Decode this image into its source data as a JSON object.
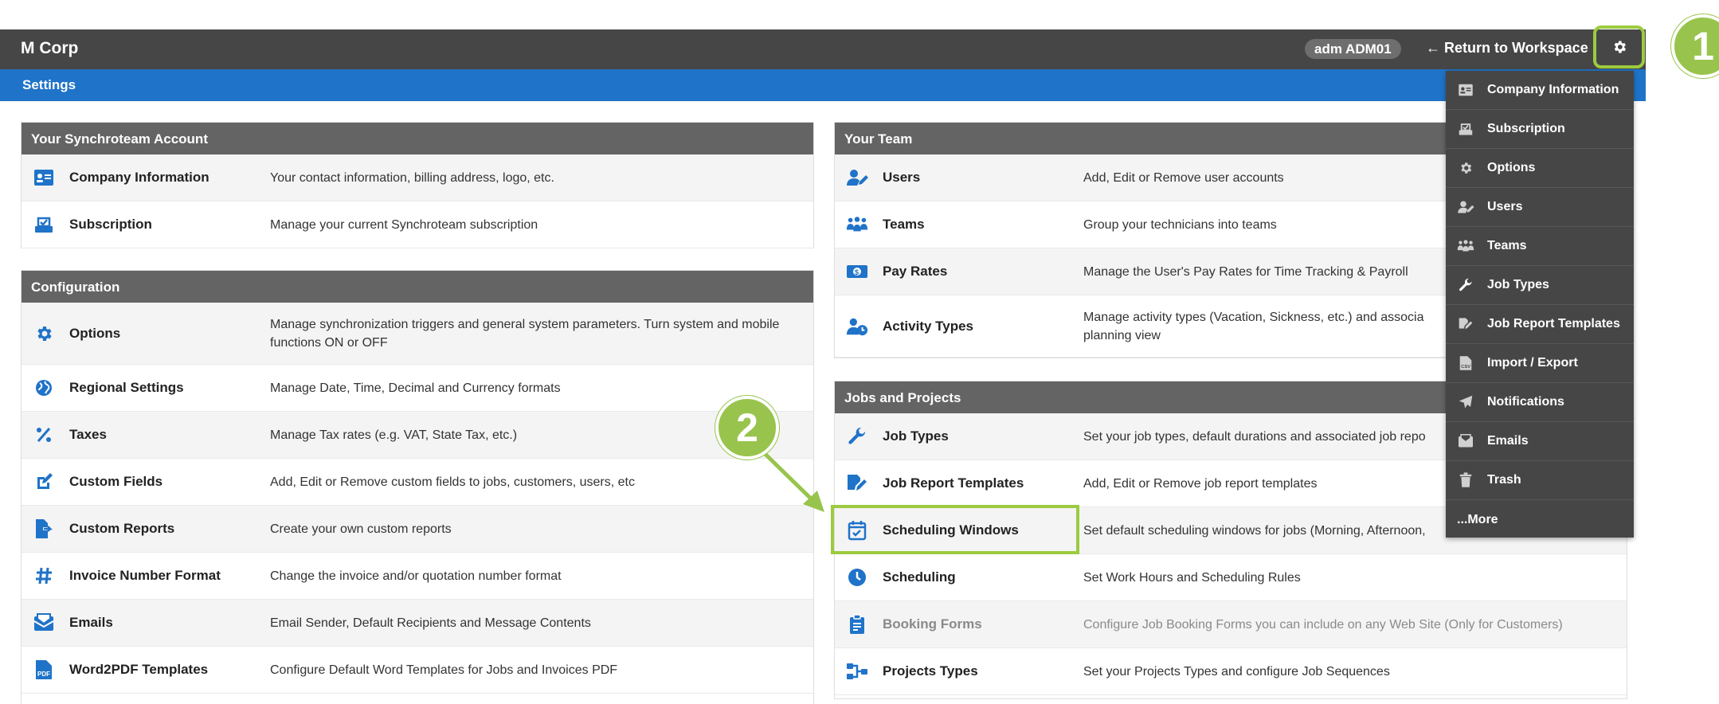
{
  "header": {
    "brand": "M Corp",
    "user_badge": "adm ADM01",
    "return_link": "← Return to Workspace",
    "settings_title": "Settings"
  },
  "account_panel": {
    "title": "Your Synchroteam Account",
    "rows": [
      {
        "name": "Company Information",
        "desc": "Your contact information, billing address, logo, etc.",
        "icon": "id-card-icon"
      },
      {
        "name": "Subscription",
        "desc": "Manage your current Synchroteam subscription",
        "icon": "subscription-icon"
      }
    ]
  },
  "config_panel": {
    "title": "Configuration",
    "rows": [
      {
        "name": "Options",
        "desc": "Manage synchronization triggers and general system parameters. Turn system and mobile functions ON or OFF",
        "icon": "gear-icon"
      },
      {
        "name": "Regional Settings",
        "desc": "Manage Date, Time, Decimal and Currency formats",
        "icon": "globe-icon"
      },
      {
        "name": "Taxes",
        "desc": "Manage Tax rates (e.g. VAT, State Tax, etc.)",
        "icon": "percent-icon"
      },
      {
        "name": "Custom Fields",
        "desc": "Add, Edit or Remove custom fields to jobs, customers, users, etc",
        "icon": "edit-icon"
      },
      {
        "name": "Custom Reports",
        "desc": "Create your own custom reports",
        "icon": "file-export-icon"
      },
      {
        "name": "Invoice Number Format",
        "desc": "Change the invoice and/or quotation number format",
        "icon": "hashtag-icon"
      },
      {
        "name": "Emails",
        "desc": "Email Sender, Default Recipients and Message Contents",
        "icon": "email-icon"
      },
      {
        "name": "Word2PDF Templates",
        "desc": "Configure Default Word Templates for Jobs and Invoices PDF",
        "icon": "pdf-icon"
      }
    ]
  },
  "team_panel": {
    "title": "Your Team",
    "rows": [
      {
        "name": "Users",
        "desc": "Add, Edit or Remove user accounts",
        "icon": "user-edit-icon"
      },
      {
        "name": "Teams",
        "desc": "Group your technicians into teams",
        "icon": "team-icon"
      },
      {
        "name": "Pay Rates",
        "desc": "Manage the User's Pay Rates for Time Tracking & Payroll",
        "icon": "money-icon"
      },
      {
        "name": "Activity Types",
        "desc": "Manage activity types (Vacation, Sickness, etc.) and associa planning view",
        "icon": "user-clock-icon"
      }
    ]
  },
  "jobs_panel": {
    "title": "Jobs and Projects",
    "rows": [
      {
        "name": "Job Types",
        "desc": "Set your job types, default durations and associated job repo",
        "icon": "wrench-icon"
      },
      {
        "name": "Job Report Templates",
        "desc": "Add, Edit or Remove job report templates",
        "icon": "report-edit-icon"
      },
      {
        "name": "Scheduling Windows",
        "desc": "Set default scheduling windows for jobs (Morning, Afternoon,",
        "icon": "calendar-check-icon"
      },
      {
        "name": "Scheduling",
        "desc": "Set Work Hours and Scheduling Rules",
        "icon": "clock-icon"
      },
      {
        "name": "Booking Forms",
        "desc": "Configure Job Booking Forms you can include on any Web Site (Only for Customers)",
        "icon": "clipboard-icon"
      },
      {
        "name": "Projects Types",
        "desc": "Set your Projects Types and configure Job Sequences",
        "icon": "sitemap-icon"
      }
    ]
  },
  "settings_menu": {
    "items": [
      {
        "label": "Company Information",
        "icon": "id-card-icon"
      },
      {
        "label": "Subscription",
        "icon": "subscription-icon"
      },
      {
        "label": "Options",
        "icon": "gear-icon"
      },
      {
        "label": "Users",
        "icon": "user-edit-icon"
      },
      {
        "label": "Teams",
        "icon": "team-icon"
      },
      {
        "label": "Job Types",
        "icon": "wrench-icon"
      },
      {
        "label": "Job Report Templates",
        "icon": "report-edit-icon"
      },
      {
        "label": "Import / Export",
        "icon": "csv-file-icon"
      },
      {
        "label": "Notifications",
        "icon": "paper-plane-icon"
      },
      {
        "label": "Emails",
        "icon": "inbox-icon"
      },
      {
        "label": "Trash",
        "icon": "trash-icon"
      },
      {
        "label": "...More",
        "icon": ""
      }
    ]
  },
  "callouts": {
    "one": "1",
    "two": "2"
  },
  "colors": {
    "topbar": "#464646",
    "subbar": "#1f73c8",
    "panel_header": "#646464",
    "icon_blue": "#1f73c8",
    "callout_green": "#98c44d",
    "highlight_green": "#9ccb3f",
    "menu_bg": "#464646"
  }
}
